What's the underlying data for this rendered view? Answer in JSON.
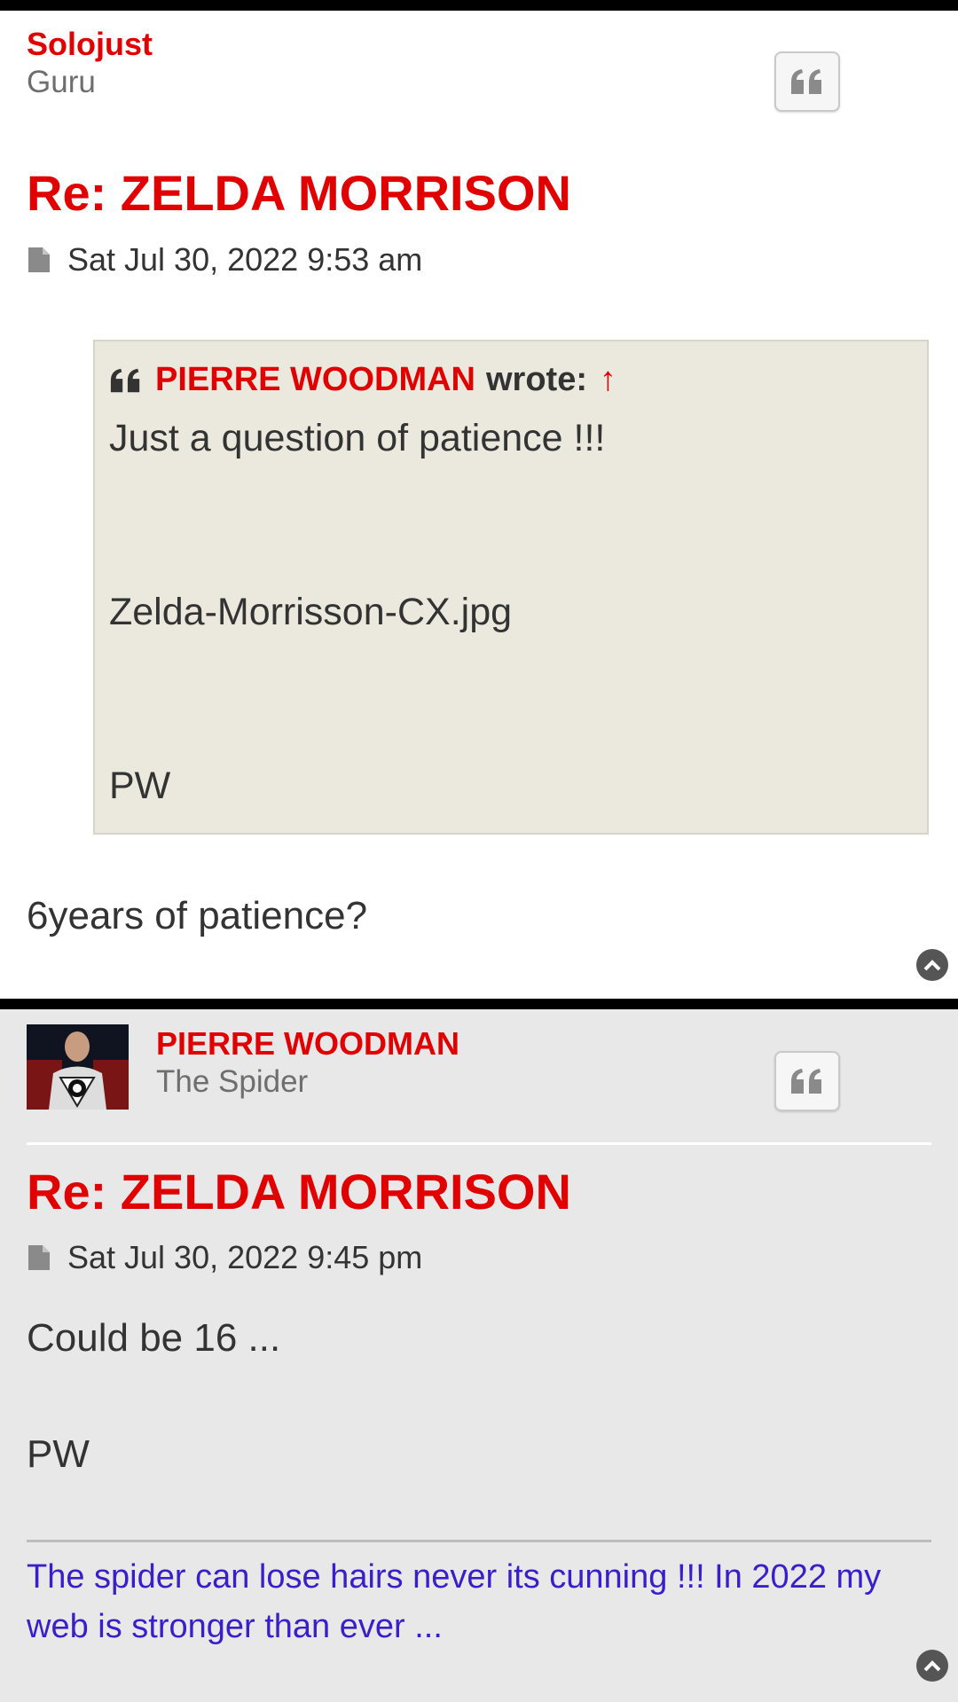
{
  "posts": [
    {
      "author": "Solojust",
      "rank": "Guru",
      "title": "Re: ZELDA MORRISON",
      "date": "Sat Jul 30, 2022 9:53 am",
      "quote": {
        "author": "PIERRE WOODMAN",
        "wrote": "wrote:",
        "lines": [
          "Just a question of patience !!!",
          "Zelda-Morrisson-CX.jpg",
          "PW"
        ]
      },
      "body": "6years of patience?"
    },
    {
      "author": "PIERRE WOODMAN",
      "rank": "The Spider",
      "title": "Re: ZELDA MORRISON",
      "date": "Sat Jul 30, 2022 9:45 pm",
      "body_lines": [
        "Could be 16 ...",
        "PW"
      ],
      "signature": "The spider can lose hairs never its cunning !!! In 2022 my web is stronger than ever ..."
    }
  ],
  "icons": {
    "quote": "quote-icon",
    "post": "file-icon",
    "back_to_top": "chevron-circle-up-icon",
    "quote_up": "arrow-up-icon"
  },
  "colors": {
    "accent": "#e00000",
    "signature": "#3a1ec8",
    "quote_bg": "#ebe9de",
    "alt_post_bg": "#e8e8e9"
  }
}
